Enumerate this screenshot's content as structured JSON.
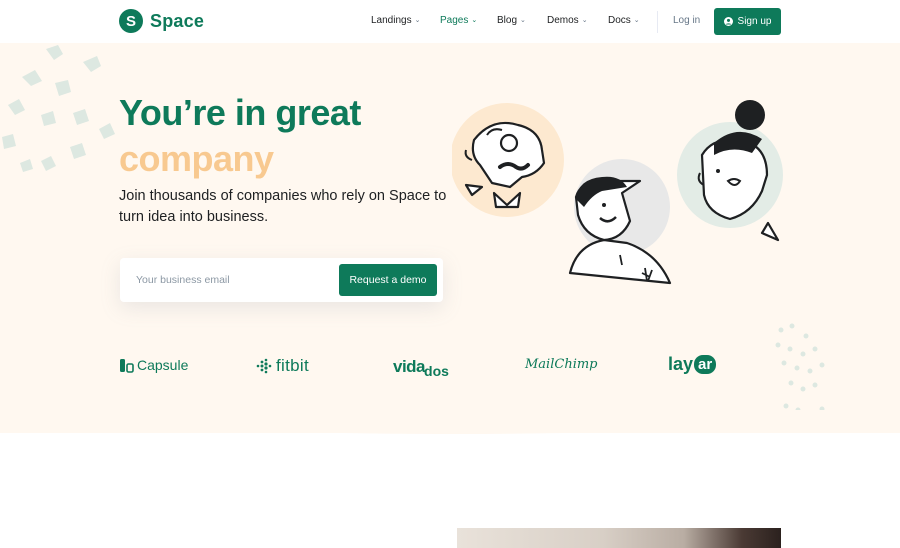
{
  "brand": {
    "logo_letter": "S",
    "name": "Space",
    "color": "#0e7a5a"
  },
  "nav": {
    "items": [
      {
        "label": "Landings",
        "has_dropdown": true,
        "active": false
      },
      {
        "label": "Pages",
        "has_dropdown": true,
        "active": true
      },
      {
        "label": "Blog",
        "has_dropdown": true,
        "active": false
      },
      {
        "label": "Demos",
        "has_dropdown": true,
        "active": false
      },
      {
        "label": "Docs",
        "has_dropdown": true,
        "active": false
      }
    ],
    "login_label": "Log in",
    "signup_label": "Sign up"
  },
  "hero": {
    "title_line1": "You’re in great",
    "title_line2": "company",
    "lead": "Join thousands of companies who rely on Space to turn idea into business.",
    "email_placeholder": "Your business email",
    "cta_label": "Request a demo",
    "colors": {
      "primary": "#0e7a5a",
      "accent": "#f8c990",
      "background": "#fff8f0"
    }
  },
  "client_logos": [
    "Capsule",
    "fitbit",
    "vida",
    "dos",
    "MailChimp",
    "lay",
    "ar"
  ],
  "icons": [
    "chevron-down-icon",
    "user-icon",
    "capsule-logo-icon",
    "fitbit-logo-icon"
  ]
}
